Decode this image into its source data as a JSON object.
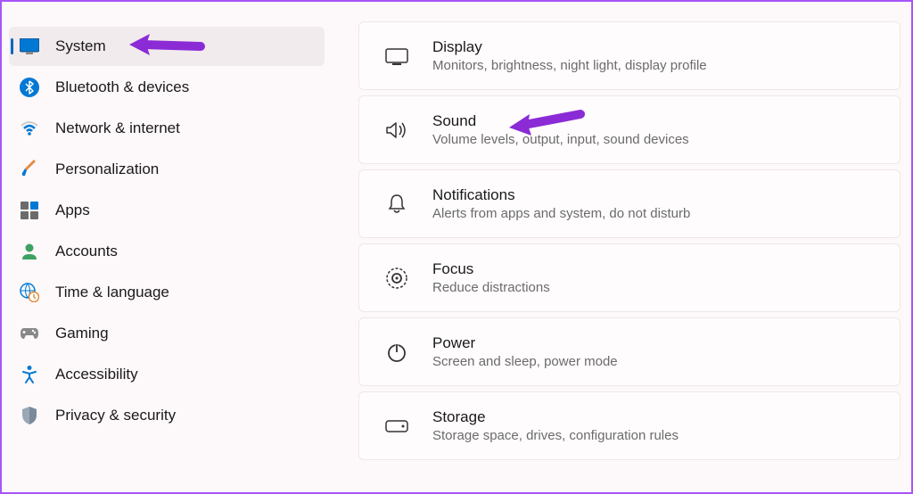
{
  "sidebar": {
    "items": [
      {
        "key": "system",
        "label": "System",
        "icon": "system-icon",
        "active": true
      },
      {
        "key": "bluetooth",
        "label": "Bluetooth & devices",
        "icon": "bluetooth-icon",
        "active": false
      },
      {
        "key": "network",
        "label": "Network & internet",
        "icon": "wifi-icon",
        "active": false
      },
      {
        "key": "personalization",
        "label": "Personalization",
        "icon": "brush-icon",
        "active": false
      },
      {
        "key": "apps",
        "label": "Apps",
        "icon": "apps-icon",
        "active": false
      },
      {
        "key": "accounts",
        "label": "Accounts",
        "icon": "person-icon",
        "active": false
      },
      {
        "key": "time",
        "label": "Time & language",
        "icon": "globe-clock-icon",
        "active": false
      },
      {
        "key": "gaming",
        "label": "Gaming",
        "icon": "gaming-icon",
        "active": false
      },
      {
        "key": "accessibility",
        "label": "Accessibility",
        "icon": "accessibility-icon",
        "active": false
      },
      {
        "key": "privacy",
        "label": "Privacy & security",
        "icon": "shield-icon",
        "active": false
      }
    ]
  },
  "main": {
    "cards": [
      {
        "key": "display",
        "title": "Display",
        "desc": "Monitors, brightness, night light, display profile",
        "icon": "monitor-icon"
      },
      {
        "key": "sound",
        "title": "Sound",
        "desc": "Volume levels, output, input, sound devices",
        "icon": "speaker-icon"
      },
      {
        "key": "notifications",
        "title": "Notifications",
        "desc": "Alerts from apps and system, do not disturb",
        "icon": "bell-icon"
      },
      {
        "key": "focus",
        "title": "Focus",
        "desc": "Reduce distractions",
        "icon": "focus-icon"
      },
      {
        "key": "power",
        "title": "Power",
        "desc": "Screen and sleep, power mode",
        "icon": "power-icon"
      },
      {
        "key": "storage",
        "title": "Storage",
        "desc": "Storage space, drives, configuration rules",
        "icon": "drive-icon"
      }
    ]
  },
  "colors": {
    "accent": "#0067c0",
    "arrow": "#8b2bd6"
  }
}
